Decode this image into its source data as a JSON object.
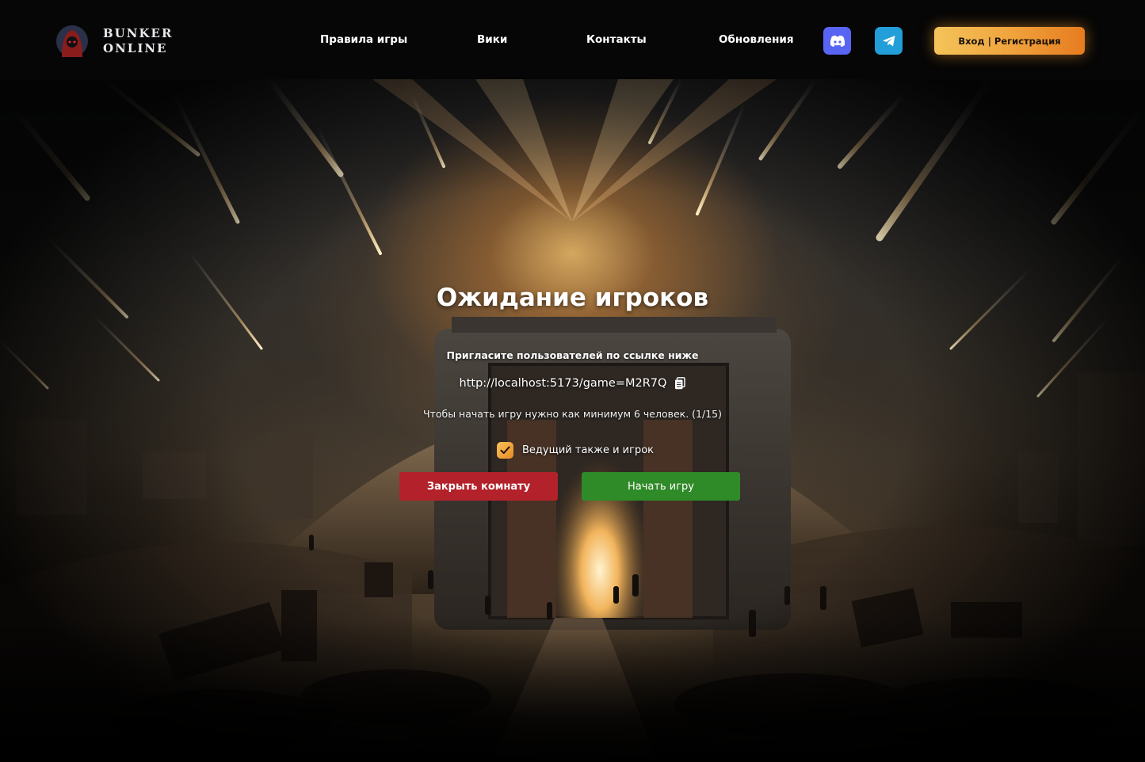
{
  "header": {
    "logo": {
      "line1": "BUNKER",
      "line2": "ONLINE"
    },
    "nav": [
      {
        "label": "Правила игры"
      },
      {
        "label": "Вики"
      },
      {
        "label": "Контакты"
      },
      {
        "label": "Обновления"
      }
    ],
    "social": [
      {
        "icon": "discord-icon",
        "color": "#5865F2"
      },
      {
        "icon": "telegram-icon",
        "color": "#229ED9"
      }
    ],
    "auth_button": "Вход | Регистрация"
  },
  "waiting": {
    "title": "Ожидание игроков",
    "invite_text": "Пригласите пользователей по ссылке ниже",
    "game_link": "http://localhost:5173/game=M2R7Q",
    "min_players_note": "Чтобы начать игру нужно как минимум 6 человек. (1/15)",
    "host_plays": {
      "label": "Ведущий также и игрок",
      "checked": true
    },
    "close_button": "Закрыть комнату",
    "start_button": "Начать игру"
  },
  "colors": {
    "accent_orange": "#f0a43d",
    "close_red": "#b3222a",
    "start_green": "#2f8a28"
  }
}
